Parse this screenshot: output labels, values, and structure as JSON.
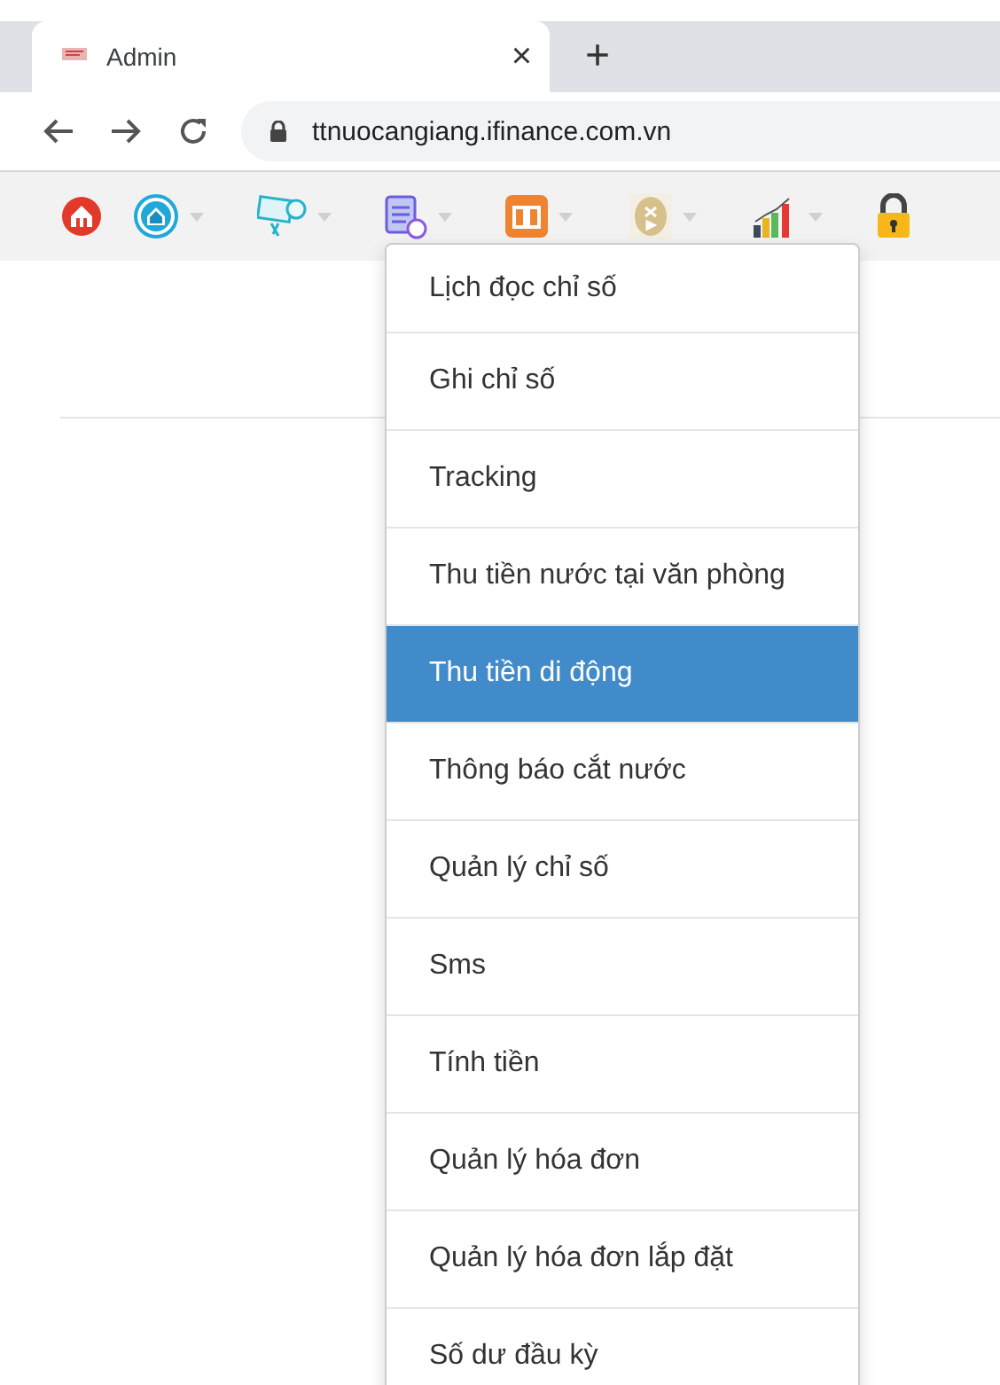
{
  "browser": {
    "tab_title": "Admin",
    "close_symbol": "×",
    "new_tab_symbol": "+",
    "url": "ttnuocangiang.ifinance.com.vn"
  },
  "toolbar": {
    "items": [
      {
        "kind": "home-red",
        "caret": false
      },
      {
        "kind": "home-blue",
        "caret": true
      },
      {
        "kind": "sms",
        "caret": true
      },
      {
        "kind": "document",
        "caret": true
      },
      {
        "kind": "book",
        "caret": true
      },
      {
        "kind": "coin",
        "caret": true
      },
      {
        "kind": "chart",
        "caret": true
      },
      {
        "kind": "lock",
        "caret": false
      }
    ]
  },
  "menu": {
    "items": [
      {
        "label": "Lịch đọc chỉ số",
        "selected": false
      },
      {
        "label": "Ghi chỉ số",
        "selected": false
      },
      {
        "label": "Tracking",
        "selected": false
      },
      {
        "label": "Thu tiền nước tại văn phòng",
        "selected": false
      },
      {
        "label": "Thu tiền di động",
        "selected": true
      },
      {
        "label": "Thông báo cắt nước",
        "selected": false
      },
      {
        "label": "Quản lý chỉ số",
        "selected": false
      },
      {
        "label": "Sms",
        "selected": false
      },
      {
        "label": "Tính tiền",
        "selected": false
      },
      {
        "label": "Quản lý hóa đơn",
        "selected": false
      },
      {
        "label": "Quản lý hóa đơn lắp đặt",
        "selected": false
      },
      {
        "label": "Số dư đầu kỳ",
        "selected": false
      }
    ]
  }
}
